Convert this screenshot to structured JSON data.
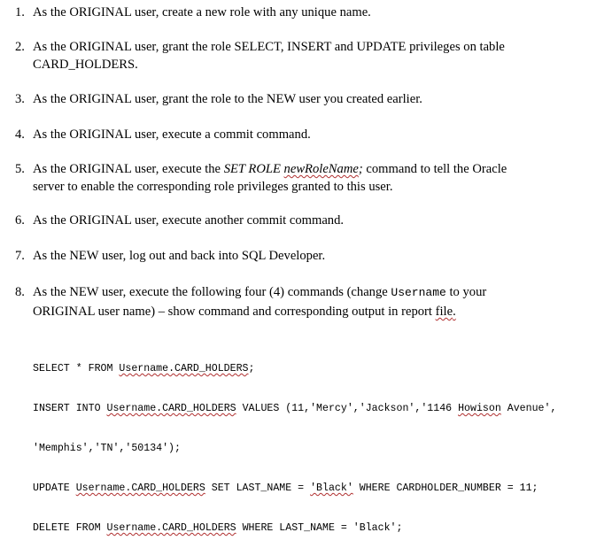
{
  "steps": [
    {
      "number": "1.",
      "parts": [
        "As the ORIGINAL user, create a new role with any unique name."
      ]
    },
    {
      "number": "2.",
      "parts": [
        "As the ORIGINAL user, grant the role SELECT, INSERT and UPDATE privileges on table",
        "CARD_HOLDERS."
      ]
    },
    {
      "number": "3.",
      "parts": [
        "As the ORIGINAL user, grant the role to the NEW user you created earlier."
      ]
    },
    {
      "number": "4.",
      "parts": [
        "As the ORIGINAL user, execute a commit command."
      ]
    },
    {
      "number": "5.",
      "a": "As the ORIGINAL user, execute the ",
      "b": "SET ROLE ",
      "c": "newRoleName",
      "d": ";",
      "e": " command to tell the Oracle",
      "f": "server to enable the corresponding role privileges granted to this user."
    },
    {
      "number": "6.",
      "parts": [
        "As the ORIGINAL user, execute another commit command."
      ]
    },
    {
      "number": "7.",
      "parts": [
        "As the NEW user, log out and back into SQL Developer."
      ]
    },
    {
      "number": "8.",
      "a": "As the NEW user, execute the following four (4) commands (change ",
      "b": "Username",
      "c": " to your",
      "d": "ORIGINAL user name) – show command and corresponding output in report ",
      "e": "file",
      "f": "."
    }
  ],
  "code": {
    "l1a": "SELECT * FROM ",
    "l1b": "Username.CARD_HOLDERS",
    "l1c": ";",
    "l2a": "INSERT INTO ",
    "l2b": "Username.CARD_HOLDERS",
    "l2c": " VALUES (11,'Mercy','Jackson','1146 ",
    "l2d": "Howison",
    "l2e": " Avenue',",
    "l3": "'Memphis','TN','50134');",
    "l4a": "UPDATE ",
    "l4b": "Username.CARD_HOLDERS",
    "l4c": " SET LAST_NAME = ",
    "l4d": "'Black'",
    "l4e": " WHERE CARDHOLDER_NUMBER = 11;",
    "l5a": "DELETE FROM ",
    "l5b": "Username.CARD_HOLDERS",
    "l5c": " WHERE LAST_NAME = 'Black';"
  }
}
